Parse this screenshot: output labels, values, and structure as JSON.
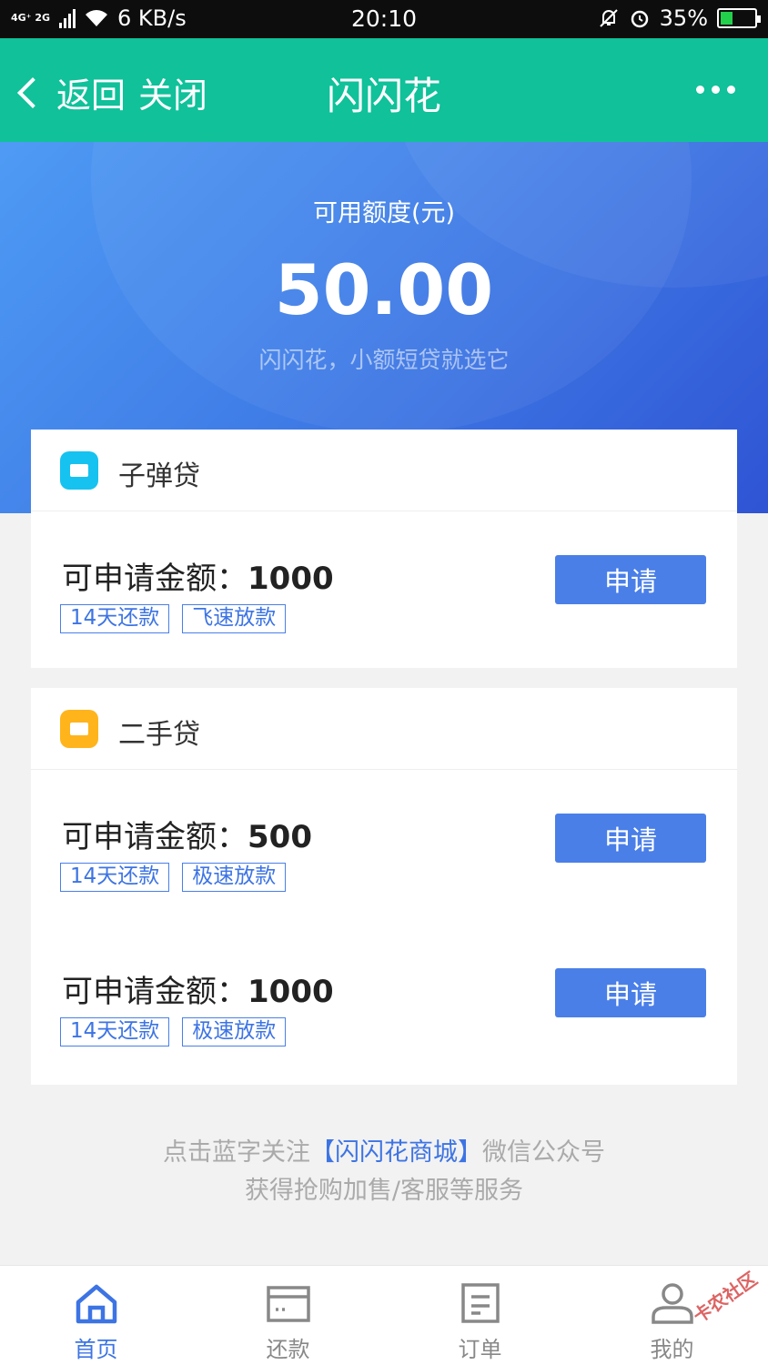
{
  "status_bar": {
    "network": "4G⁺ 2G",
    "speed": "6 KB/s",
    "time": "20:10",
    "battery": "35%",
    "battery_level": 0.35,
    "icons": [
      "signal-icon",
      "wifi-icon",
      "mute-icon",
      "alarm-icon",
      "battery-icon"
    ]
  },
  "header": {
    "back_label": "返回",
    "close_label": "关闭",
    "title": "闪闪花",
    "more_icon": "more-dots-icon",
    "color": "#10c19a"
  },
  "hero": {
    "label": "可用额度(元)",
    "amount": "50.00",
    "slogan": "闪闪花，小额短贷就选它",
    "gradient": [
      "#4e9bf4",
      "#2f54d4"
    ]
  },
  "products": [
    {
      "name": "子弹贷",
      "logo_color": "#16c2f0",
      "offers": [
        {
          "amount_label": "可申请金额：",
          "amount": "1000",
          "tags": [
            "14天还款",
            "飞速放款"
          ],
          "button": "申请"
        }
      ]
    },
    {
      "name": "二手贷",
      "logo_color": "#ffb41c",
      "offers": [
        {
          "amount_label": "可申请金额：",
          "amount": "500",
          "tags": [
            "14天还款",
            "极速放款"
          ],
          "button": "申请"
        },
        {
          "amount_label": "可申请金额：",
          "amount": "1000",
          "tags": [
            "14天还款",
            "极速放款"
          ],
          "button": "申请"
        }
      ]
    }
  ],
  "note": {
    "line1_prefix": "点击蓝字关注",
    "line1_link": "【闪闪花商城】",
    "line1_suffix": "微信公众号",
    "line2": "获得抢购加售/客服等服务"
  },
  "tabbar": [
    {
      "label": "首页",
      "icon": "home-icon",
      "active": true
    },
    {
      "label": "还款",
      "icon": "card-icon",
      "active": false
    },
    {
      "label": "订单",
      "icon": "document-icon",
      "active": false
    },
    {
      "label": "我的",
      "icon": "user-icon",
      "active": false
    }
  ],
  "watermark": "卡农社区",
  "accent": "#4a7fe8"
}
